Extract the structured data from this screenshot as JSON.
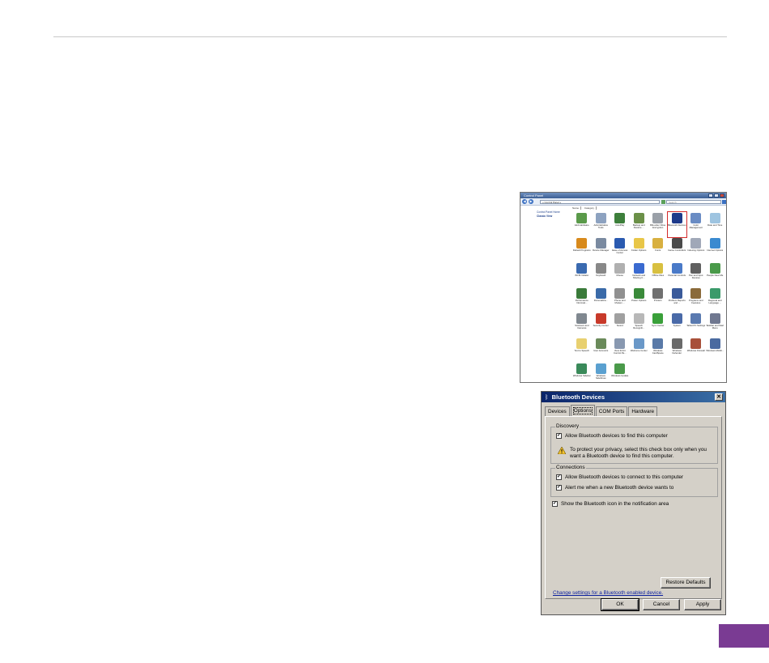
{
  "control_panel": {
    "title": "Control Panel",
    "address": "« Control Panel »",
    "search_placeholder": "Search",
    "nav_back": "◀",
    "nav_forward": "▶",
    "sidebar": {
      "home": "Control Panel Home",
      "classic_view": "Classic View"
    },
    "column_headers": [
      "Name",
      "Category"
    ],
    "items": [
      {
        "label": "Add Hardware",
        "color": "#5a9a4a"
      },
      {
        "label": "Administrative Tools",
        "color": "#8da2c0"
      },
      {
        "label": "AutoPlay",
        "color": "#3d7f3b"
      },
      {
        "label": "Backup and Restore ...",
        "color": "#6b9048"
      },
      {
        "label": "BitLocker Drive Encryption",
        "color": "#9aa0a8"
      },
      {
        "label": "Bluetooth Devices",
        "color": "#1d3a8a"
      },
      {
        "label": "Color Management",
        "color": "#6a8cc4"
      },
      {
        "label": "Date and Time",
        "color": "#9ec4e0"
      },
      {
        "label": "Default Programs",
        "color": "#d88a1c"
      },
      {
        "label": "Device Manager",
        "color": "#7a8aa0"
      },
      {
        "label": "Ease of Access Center",
        "color": "#2a5ab0"
      },
      {
        "label": "Folder Options",
        "color": "#e8c648"
      },
      {
        "label": "Fonts",
        "color": "#d8b040"
      },
      {
        "label": "Game Controllers",
        "color": "#4a4a4a"
      },
      {
        "label": "Indexing Options",
        "color": "#a0a8b8"
      },
      {
        "label": "Internet Options",
        "color": "#3a8ad0"
      },
      {
        "label": "iSCSI Initiator",
        "color": "#3a6ab0"
      },
      {
        "label": "Keyboard",
        "color": "#888888"
      },
      {
        "label": "Mouse",
        "color": "#b0b0b0"
      },
      {
        "label": "Network and Sharing C...",
        "color": "#3a6ad0"
      },
      {
        "label": "Offline Files",
        "color": "#d8c040"
      },
      {
        "label": "Parental Controls",
        "color": "#4a7ac8"
      },
      {
        "label": "Pen and Input Devices",
        "color": "#606060"
      },
      {
        "label": "People Near Me",
        "color": "#4a9a4a"
      },
      {
        "label": "Performance Informati...",
        "color": "#3a7a3a"
      },
      {
        "label": "Personaliza...",
        "color": "#3a6aa8"
      },
      {
        "label": "Phone and Modem ...",
        "color": "#909090"
      },
      {
        "label": "Power Options",
        "color": "#3a8a3a"
      },
      {
        "label": "Printers",
        "color": "#707070"
      },
      {
        "label": "Problem Reports and ...",
        "color": "#3a5a9a"
      },
      {
        "label": "Programs and Features",
        "color": "#8a6a3a"
      },
      {
        "label": "Regional and Language ...",
        "color": "#3a9a6a"
      },
      {
        "label": "Scanners and Cameras",
        "color": "#808890"
      },
      {
        "label": "Security Center",
        "color": "#c83a2a"
      },
      {
        "label": "Sound",
        "color": "#a0a0a0"
      },
      {
        "label": "Speech Recogniti...",
        "color": "#b8b8b8"
      },
      {
        "label": "Sync Center",
        "color": "#3aa03a"
      },
      {
        "label": "System",
        "color": "#4a6aa8"
      },
      {
        "label": "Tablet PC Settings",
        "color": "#5a7ab0"
      },
      {
        "label": "Taskbar and Start Menu",
        "color": "#707890"
      },
      {
        "label": "Text to Speech",
        "color": "#e8d070"
      },
      {
        "label": "User Accounts",
        "color": "#6a8a5a"
      },
      {
        "label": "View 32-bit Control Pa...",
        "color": "#8898b0"
      },
      {
        "label": "Welcome Center",
        "color": "#6a98c8"
      },
      {
        "label": "Windows CardSpace",
        "color": "#5a7aa8"
      },
      {
        "label": "Windows Defender",
        "color": "#6a6a6a"
      },
      {
        "label": "Windows Firewall",
        "color": "#a8503a"
      },
      {
        "label": "Windows Mobili...",
        "color": "#4a6aa0"
      },
      {
        "label": "Windows Sidebar ...",
        "color": "#3a8a5a"
      },
      {
        "label": "Windows SideShow",
        "color": "#5aa0d0"
      },
      {
        "label": "Windows Update",
        "color": "#4a9a4a"
      }
    ]
  },
  "bluetooth_dialog": {
    "title": "Bluetooth Devices",
    "close": "✕",
    "tabs": [
      "Devices",
      "Options",
      "COM Ports",
      "Hardware"
    ],
    "discovery": {
      "legend": "Discovery",
      "allow_find": "Allow Bluetooth devices to find this computer",
      "allow_find_checked": true,
      "warning": "To protect your privacy, select this check box only when you want a Bluetooth device to find this computer."
    },
    "connections": {
      "legend": "Connections",
      "allow_connect": "Allow Bluetooth devices to connect to this computer",
      "allow_connect_checked": true,
      "alert_new": "Alert me when a new Bluetooth device wants to",
      "alert_new_checked": true
    },
    "show_icon": "Show the Bluetooth icon in the notification area",
    "show_icon_checked": true,
    "link": "Change settings for a Bluetooth enabled device.",
    "restore_defaults": "Restore Defaults",
    "ok": "OK",
    "cancel": "Cancel",
    "apply": "Apply",
    "checkmark": "✓"
  },
  "colors": {
    "accent_tab": "#7a3b93",
    "rule": "#c8c8c8"
  }
}
